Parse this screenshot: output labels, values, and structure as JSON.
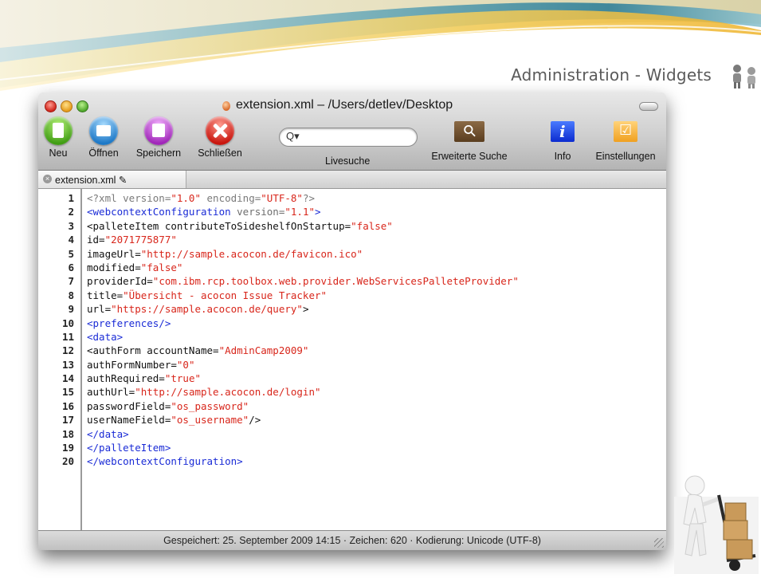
{
  "slide": {
    "title": "Administration - Widgets"
  },
  "window": {
    "title": "extension.xml – /Users/detlev/Desktop",
    "toolbar": {
      "new_label": "Neu",
      "open_label": "Öffnen",
      "save_label": "Speichern",
      "close_label": "Schließen",
      "search_label": "Livesuche",
      "search_placeholder": "Q▾",
      "advanced_search_label": "Erweiterte Suche",
      "info_label": "Info",
      "settings_label": "Einstellungen"
    },
    "tab": {
      "label": "extension.xml ✎"
    },
    "status": "Gespeichert: 25. September 2009 14:15  ·  Zeichen: 620  ·  Kodierung: Unicode (UTF-8)"
  },
  "code": {
    "lines": [
      {
        "n": "1",
        "parts": [
          [
            "decl",
            "<?xml version="
          ],
          [
            "val",
            "\"1.0\""
          ],
          [
            "decl",
            " encoding="
          ],
          [
            "val",
            "\"UTF-8\""
          ],
          [
            "decl",
            "?>"
          ]
        ]
      },
      {
        "n": "2",
        "parts": [
          [
            "tag",
            "<webcontextConfiguration "
          ],
          [
            "gray",
            "version="
          ],
          [
            "val",
            "\"1.1\""
          ],
          [
            "tag",
            ">"
          ]
        ]
      },
      {
        "n": "3",
        "parts": [
          [
            "attr",
            "<palleteItem contributeToSideshelfOnStartup="
          ],
          [
            "val",
            "\"false\""
          ]
        ]
      },
      {
        "n": "4",
        "parts": [
          [
            "attr",
            "id="
          ],
          [
            "val",
            "\"2071775877\""
          ]
        ]
      },
      {
        "n": "5",
        "parts": [
          [
            "attr",
            "imageUrl="
          ],
          [
            "val",
            "\"http://sample.acocon.de/favicon.ico\""
          ]
        ]
      },
      {
        "n": "6",
        "parts": [
          [
            "attr",
            "modified="
          ],
          [
            "val",
            "\"false\""
          ]
        ]
      },
      {
        "n": "7",
        "parts": [
          [
            "attr",
            "providerId="
          ],
          [
            "val",
            "\"com.ibm.rcp.toolbox.web.provider.WebServicesPalleteProvider\""
          ]
        ]
      },
      {
        "n": "8",
        "parts": [
          [
            "attr",
            "title="
          ],
          [
            "val",
            "\"Übersicht - acocon Issue Tracker\""
          ]
        ]
      },
      {
        "n": "9",
        "parts": [
          [
            "attr",
            "url="
          ],
          [
            "val",
            "\"https://sample.acocon.de/query\""
          ],
          [
            "attr",
            ">"
          ]
        ]
      },
      {
        "n": "10",
        "parts": [
          [
            "tag",
            "<preferences/>"
          ]
        ]
      },
      {
        "n": "11",
        "parts": [
          [
            "tag",
            "<data>"
          ]
        ]
      },
      {
        "n": "12",
        "parts": [
          [
            "attr",
            "<authForm accountName="
          ],
          [
            "val",
            "\"AdminCamp2009\""
          ]
        ]
      },
      {
        "n": "13",
        "parts": [
          [
            "attr",
            "authFormNumber="
          ],
          [
            "val",
            "\"0\""
          ]
        ]
      },
      {
        "n": "14",
        "parts": [
          [
            "attr",
            "authRequired="
          ],
          [
            "val",
            "\"true\""
          ]
        ]
      },
      {
        "n": "15",
        "parts": [
          [
            "attr",
            "authUrl="
          ],
          [
            "val",
            "\"http://sample.acocon.de/login\""
          ]
        ]
      },
      {
        "n": "16",
        "parts": [
          [
            "attr",
            "passwordField="
          ],
          [
            "val",
            "\"os_password\""
          ]
        ]
      },
      {
        "n": "17",
        "parts": [
          [
            "attr",
            "userNameField="
          ],
          [
            "val",
            "\"os_username\""
          ],
          [
            "attr",
            "/>"
          ]
        ]
      },
      {
        "n": "18",
        "parts": [
          [
            "tag",
            "</data>"
          ]
        ]
      },
      {
        "n": "19",
        "parts": [
          [
            "tag",
            "</palleteItem>"
          ]
        ]
      },
      {
        "n": "20",
        "parts": [
          [
            "tag",
            "</webcontextConfiguration>"
          ]
        ]
      }
    ]
  },
  "colors": {
    "tag": "#1a2bd6",
    "value": "#d8261b",
    "swoosh_teal": "#5fa9b8",
    "swoosh_yellow": "#f2c44a"
  }
}
